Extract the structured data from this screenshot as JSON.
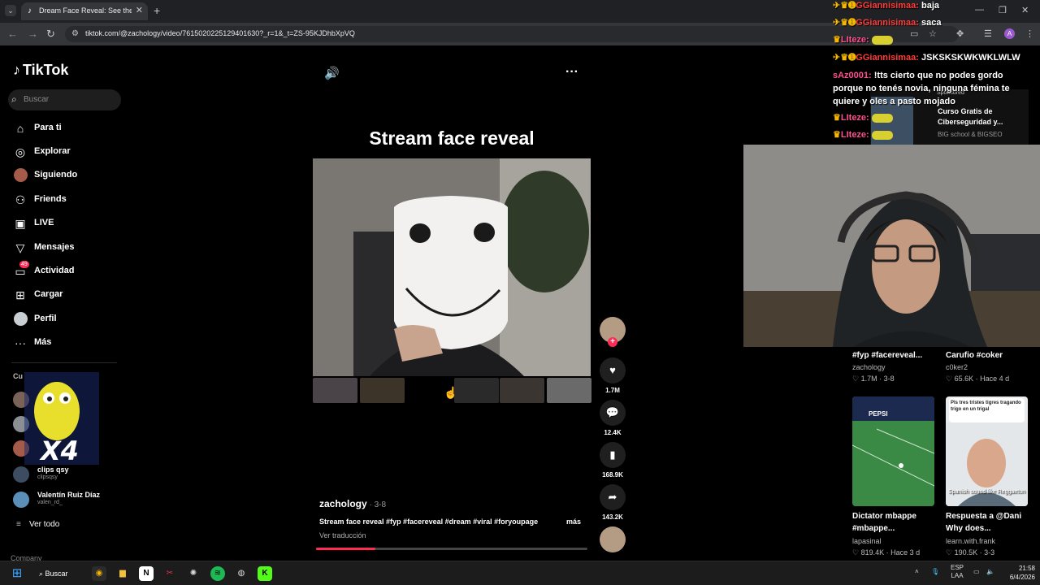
{
  "browser": {
    "tab_title": "Dream Face Reveal: See the Vir",
    "url": "tiktok.com/@zachology/video/7615020225129401630?_r=1&_t=ZS-95KJDhbXpVQ"
  },
  "sidebar": {
    "brand": "TikTok",
    "search_placeholder": "Buscar",
    "nav": [
      {
        "label": "Para ti",
        "icon": "home-icon"
      },
      {
        "label": "Explorar",
        "icon": "compass-icon"
      },
      {
        "label": "Siguiendo",
        "icon": "avatar-icon"
      },
      {
        "label": "Friends",
        "icon": "friends-icon"
      },
      {
        "label": "LIVE",
        "icon": "live-icon"
      },
      {
        "label": "Mensajes",
        "icon": "message-icon"
      },
      {
        "label": "Actividad",
        "icon": "inbox-icon",
        "badge": "49"
      },
      {
        "label": "Cargar",
        "icon": "upload-icon"
      },
      {
        "label": "Perfil",
        "icon": "profile-avatar-icon"
      },
      {
        "label": "Más",
        "icon": "more-icon"
      }
    ],
    "following_section": "Cu",
    "following": [
      {
        "name": "clips qsy",
        "handle": "clipsqsy"
      },
      {
        "name": "Valentín Ruiz Díaz",
        "handle": "valen_rd_"
      }
    ],
    "see_all": "Ver todo",
    "company": "Company",
    "overlay_text": "X4"
  },
  "video": {
    "title": "Stream face reveal",
    "author": "zachology",
    "date": "3-8",
    "description": "Stream face reveal #fyp #facereveal #dream #viral #foryoupage",
    "more": "más",
    "translate": "Ver traducción",
    "likes": "1.7M",
    "comments": "12.4K",
    "saves": "168.9K",
    "shares": "143.2K",
    "progress": 0.22
  },
  "chat": [
    {
      "user": "GGiannisimaa:",
      "msg": "baja"
    },
    {
      "user": "GGiannisimaa:",
      "msg": "saca"
    },
    {
      "user": "LIteze:",
      "msg": ""
    },
    {
      "user": "GGiannisimaa:",
      "msg": "JSKSKSKWKWKLWLW"
    },
    {
      "user": "sAz0001:",
      "msg": "!tts cierto que no podes gordo porque no tenés novia, ninguna fémina te quiere y oles a pasto mojado"
    },
    {
      "user": "LIteze:",
      "msg": ""
    },
    {
      "user": "LIteze:",
      "msg": ""
    }
  ],
  "sponsored": {
    "tag": "Sponsored",
    "title": "Curso Gratis de Ciberseguridad y...",
    "advertiser": "BIG school & BIGSEO"
  },
  "feed": [
    {
      "title": "#fyp #facereveal...",
      "author": "zachology",
      "likes": "1.7M",
      "date": "3-8"
    },
    {
      "title": "Carufio #coker",
      "author": "c0ker2",
      "likes": "65.6K",
      "date": "Hace 4 d"
    },
    {
      "title": "Dictator mbappe #mbappe...",
      "author": "lapasinal",
      "likes": "819.4K",
      "date": "Hace 3 d",
      "thumb_text": "PEPSI"
    },
    {
      "title": "Respuesta a @Dani Why does...",
      "author": "learn.with.frank",
      "likes": "190.5K",
      "date": "3-3",
      "thumb_text": "Pls tres tristes tigres tragando trigo en un trigal",
      "thumb_caption": "Spanish sound like Reggaeton"
    }
  ],
  "taskbar": {
    "search": "Buscar",
    "lang1": "ESP",
    "lang2": "LAA",
    "time": "21:58",
    "date": "6/4/2026"
  }
}
